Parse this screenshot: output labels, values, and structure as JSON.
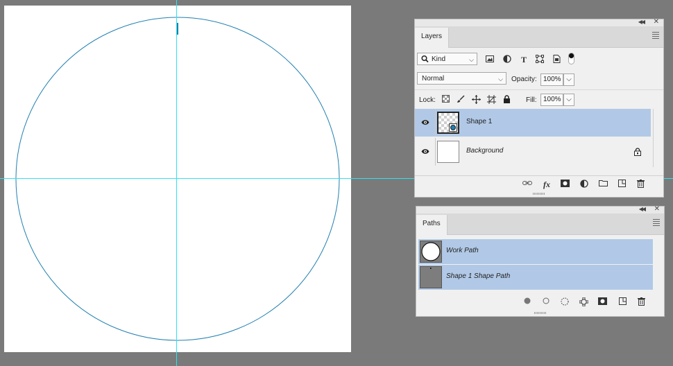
{
  "layers_panel": {
    "tab_label": "Layers",
    "filter": {
      "value": "Kind"
    },
    "blend_mode": {
      "value": "Normal"
    },
    "opacity": {
      "label": "Opacity:",
      "value": "100%"
    },
    "lock": {
      "label": "Lock:"
    },
    "fill": {
      "label": "Fill:",
      "value": "100%"
    },
    "layers": [
      {
        "name": "Shape 1",
        "selected": true,
        "italic": false
      },
      {
        "name": "Background",
        "selected": false,
        "italic": true,
        "locked": true
      }
    ]
  },
  "paths_panel": {
    "tab_label": "Paths",
    "paths": [
      {
        "name": "Work Path"
      },
      {
        "name": "Shape 1 Shape Path"
      }
    ]
  },
  "colors": {
    "workspace": "#7a7a7a",
    "guide": "#2fe3f2",
    "path_stroke": "#1f7fb0",
    "selection": "#b1c9e6"
  }
}
